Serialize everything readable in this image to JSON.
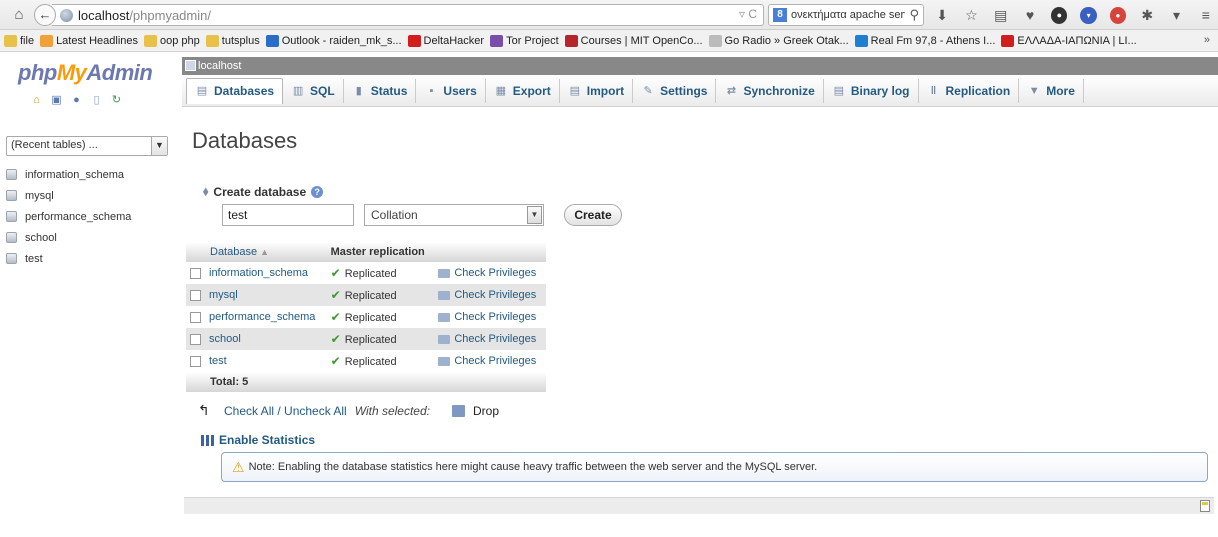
{
  "browser": {
    "url_host": "localhost",
    "url_path": "/phpmyadmin/",
    "search_text": "ονεκτήματα apache server",
    "bookmarks": [
      {
        "label": "file",
        "color": "#e8c14a"
      },
      {
        "label": "Latest Headlines",
        "color": "#f0a23a"
      },
      {
        "label": "oop php",
        "color": "#e8c14a"
      },
      {
        "label": "tutsplus",
        "color": "#e8c14a"
      },
      {
        "label": "Outlook - raiden_mk_s...",
        "color": "#2a6cc7"
      },
      {
        "label": "DeltaHacker",
        "color": "#d21d1d"
      },
      {
        "label": "Tor Project",
        "color": "#7a4ea8"
      },
      {
        "label": "Courses | MIT OpenCo...",
        "color": "#b5252b"
      },
      {
        "label": "Go Radio » Greek Otak...",
        "color": "#bbbbbb"
      },
      {
        "label": "Real Fm 97,8 - Athens I...",
        "color": "#1e7ed1"
      },
      {
        "label": "ΕΛΛΑΔΑ-ΙΑΠΩΝΙΑ | LI...",
        "color": "#d21d1d"
      }
    ]
  },
  "left": {
    "logo": {
      "php": "php",
      "my": "My",
      "admin": "Admin"
    },
    "recent_tables": "(Recent tables) ...",
    "databases": [
      "information_schema",
      "mysql",
      "performance_schema",
      "school",
      "test"
    ]
  },
  "topbar": {
    "server": "localhost"
  },
  "tabs": [
    {
      "label": "Databases",
      "icon": "database-icon"
    },
    {
      "label": "SQL",
      "icon": "sql-icon"
    },
    {
      "label": "Status",
      "icon": "status-icon"
    },
    {
      "label": "Users",
      "icon": "users-icon"
    },
    {
      "label": "Export",
      "icon": "export-icon"
    },
    {
      "label": "Import",
      "icon": "import-icon"
    },
    {
      "label": "Settings",
      "icon": "settings-icon"
    },
    {
      "label": "Synchronize",
      "icon": "synchronize-icon"
    },
    {
      "label": "Binary log",
      "icon": "binary-log-icon"
    },
    {
      "label": "Replication",
      "icon": "replication-icon"
    },
    {
      "label": "More",
      "icon": "more-arrow-icon"
    }
  ],
  "main": {
    "title": "Databases",
    "create_label": "Create database",
    "dbname_value": "test",
    "collation_placeholder": "Collation",
    "create_button": "Create",
    "table": {
      "headers": [
        "Database",
        "Master replication"
      ],
      "rows": [
        {
          "name": "information_schema",
          "status": "Replicated",
          "action": "Check Privileges"
        },
        {
          "name": "mysql",
          "status": "Replicated",
          "action": "Check Privileges"
        },
        {
          "name": "performance_schema",
          "status": "Replicated",
          "action": "Check Privileges"
        },
        {
          "name": "school",
          "status": "Replicated",
          "action": "Check Privileges"
        },
        {
          "name": "test",
          "status": "Replicated",
          "action": "Check Privileges"
        }
      ],
      "total": "Total: 5"
    },
    "check_all": "Check All / Uncheck All",
    "with_selected": "With selected:",
    "drop": "Drop",
    "enable_stats": "Enable Statistics",
    "notice": "Note: Enabling the database statistics here might cause heavy traffic between the web server and the MySQL server."
  }
}
